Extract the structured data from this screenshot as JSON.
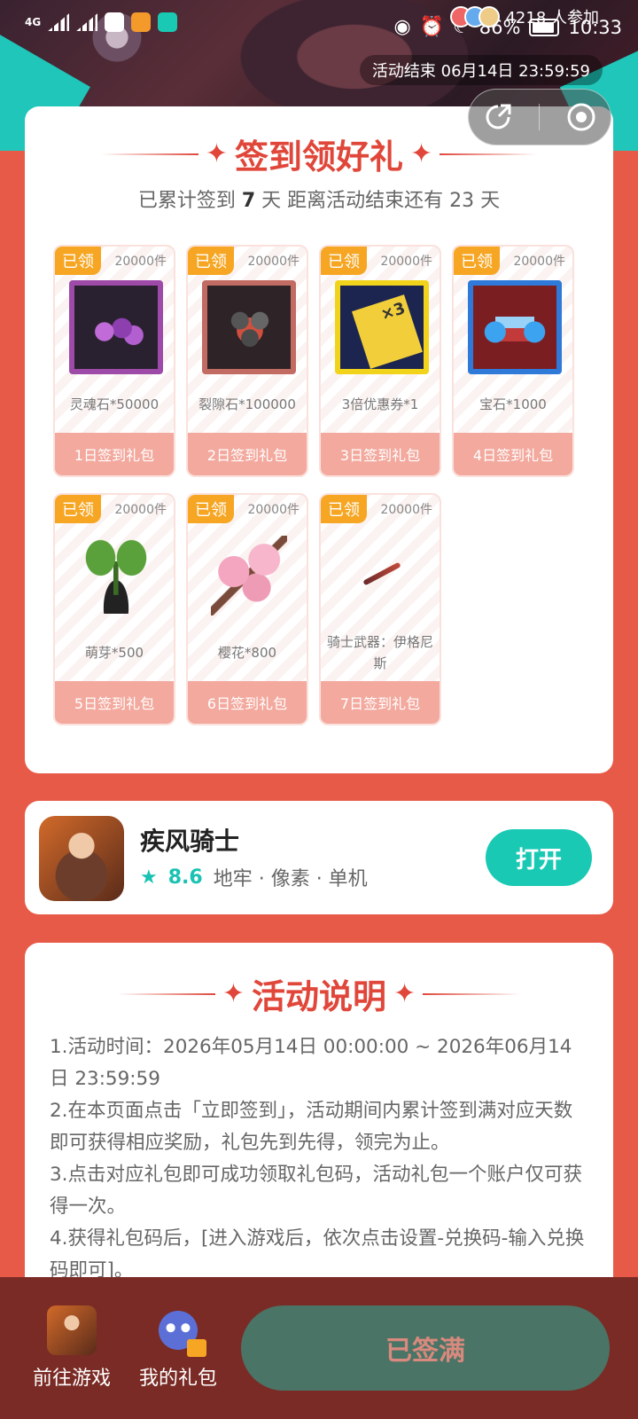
{
  "status_bar": {
    "network": "4G",
    "battery": "86%",
    "time": "10:33"
  },
  "header": {
    "participants_text": "4218 人参加",
    "end_time_label": "活动结束 06月14日 23:59:59"
  },
  "signin": {
    "title": "签到领好礼",
    "progress_prefix": "已累计签到",
    "progress_days": "7",
    "progress_suffix": "天  距离活动结束还有 23 天",
    "gifts": [
      {
        "tag": "已领",
        "count": "20000件",
        "name": "灵魂石*50000",
        "label": "1日签到礼包",
        "icon": "soul-stone-icon"
      },
      {
        "tag": "已领",
        "count": "20000件",
        "name": "裂隙石*100000",
        "label": "2日签到礼包",
        "icon": "rift-stone-icon"
      },
      {
        "tag": "已领",
        "count": "20000件",
        "name": "3倍优惠券*1",
        "label": "3日签到礼包",
        "icon": "coupon-icon"
      },
      {
        "tag": "已领",
        "count": "20000件",
        "name": "宝石*1000",
        "label": "4日签到礼包",
        "icon": "gem-chest-icon"
      },
      {
        "tag": "已领",
        "count": "20000件",
        "name": "萌芽*500",
        "label": "5日签到礼包",
        "icon": "sprout-icon"
      },
      {
        "tag": "已领",
        "count": "20000件",
        "name": "樱花*800",
        "label": "6日签到礼包",
        "icon": "sakura-icon"
      },
      {
        "tag": "已领",
        "count": "20000件",
        "name": "骑士武器：伊格尼斯",
        "label": "7日签到礼包",
        "icon": "sword-icon"
      }
    ]
  },
  "game": {
    "name": "疾风骑士",
    "rating": "8.6",
    "tags": "地牢 · 像素 · 单机",
    "open_label": "打开"
  },
  "rules": {
    "title": "活动说明",
    "lines": [
      "1.活动时间：2026年05月14日 00:00:00 ~ 2026年06月14日 23:59:59",
      "2.在本页面点击「立即签到」，活动期间内累计签到满对应天数即可获得相应奖励，礼包先到先得，领完为止。",
      "3.点击对应礼包即可成功领取礼包码，活动礼包一个账户仅可获得一次。",
      "4.获得礼包码后，[进入游戏后，依次点击设置-兑换码-输入兑换码即可]。"
    ]
  },
  "bottom_bar": {
    "go_game_label": "前往游戏",
    "my_gifts_label": "我的礼包",
    "signed_label": "已签满"
  },
  "colors": {
    "page_bg": "#e85a48",
    "accent_red": "#e0473a",
    "teal": "#19c9b4",
    "tag_orange": "#f6a623",
    "gift_footer": "#f3a99e",
    "bottom_bar": "#7a2b25",
    "signed_button": "#4a7466"
  }
}
